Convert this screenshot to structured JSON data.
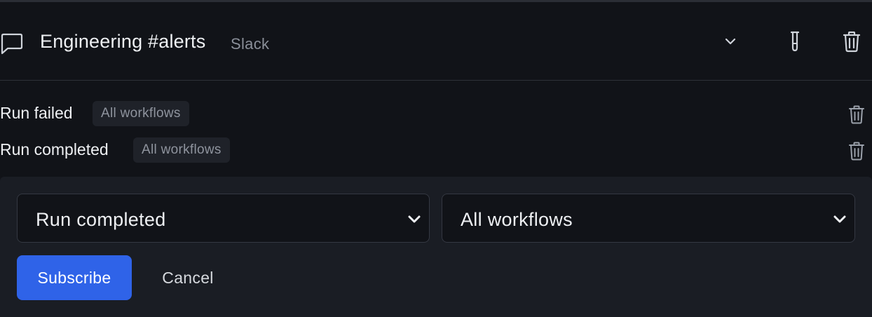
{
  "channel": {
    "name": "Engineering #alerts",
    "type": "Slack",
    "icon": "chat-bubble-icon",
    "actions": [
      "chevron-down-icon",
      "test-tube-icon",
      "trash-icon"
    ]
  },
  "subscriptions": [
    {
      "event": "Run failed",
      "scope": "All workflows"
    },
    {
      "event": "Run completed",
      "scope": "All workflows"
    }
  ],
  "form": {
    "event_select": {
      "value": "Run completed"
    },
    "workflow_select": {
      "value": "All workflows"
    },
    "subscribe_label": "Subscribe",
    "cancel_label": "Cancel"
  },
  "colors": {
    "background": "#111318",
    "panel": "#1a1d24",
    "primary": "#2f63e8",
    "muted_text": "#8a8f99"
  }
}
